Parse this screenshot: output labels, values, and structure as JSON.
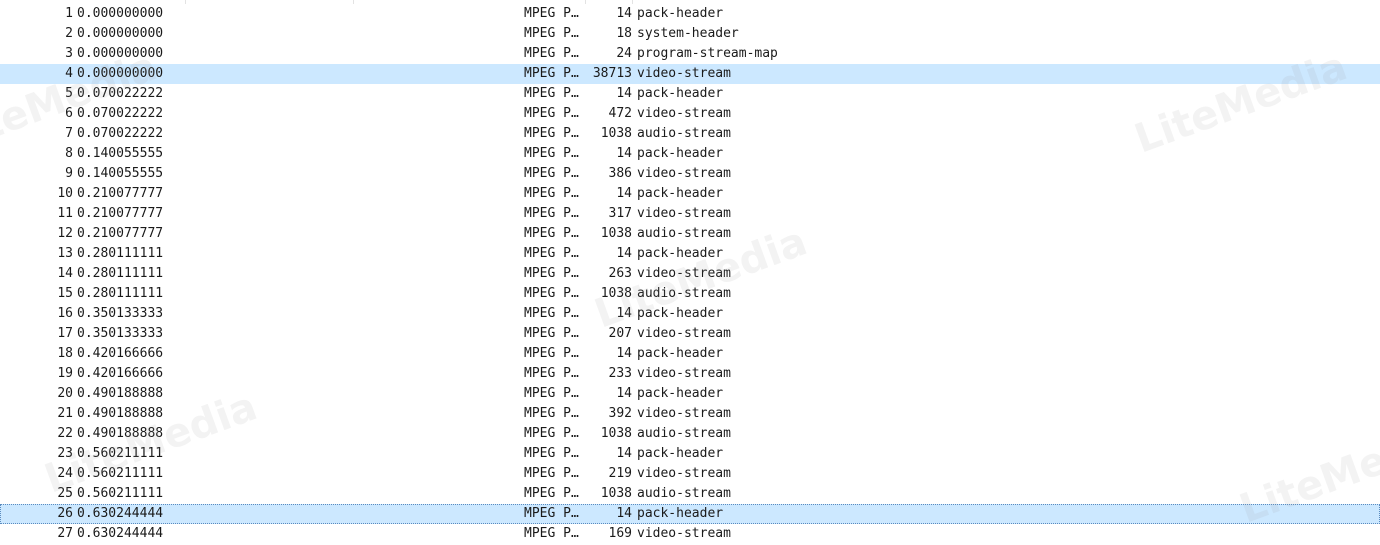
{
  "packets": [
    {
      "no": "1",
      "time": "0.000000000",
      "protocol": "MPEG P…",
      "length": "14",
      "info": "pack-header"
    },
    {
      "no": "2",
      "time": "0.000000000",
      "protocol": "MPEG P…",
      "length": "18",
      "info": "system-header"
    },
    {
      "no": "3",
      "time": "0.000000000",
      "protocol": "MPEG P…",
      "length": "24",
      "info": "program-stream-map"
    },
    {
      "no": "4",
      "time": "0.000000000",
      "protocol": "MPEG P…",
      "length": "38713",
      "info": "video-stream"
    },
    {
      "no": "5",
      "time": "0.070022222",
      "protocol": "MPEG P…",
      "length": "14",
      "info": "pack-header"
    },
    {
      "no": "6",
      "time": "0.070022222",
      "protocol": "MPEG P…",
      "length": "472",
      "info": "video-stream"
    },
    {
      "no": "7",
      "time": "0.070022222",
      "protocol": "MPEG P…",
      "length": "1038",
      "info": "audio-stream"
    },
    {
      "no": "8",
      "time": "0.140055555",
      "protocol": "MPEG P…",
      "length": "14",
      "info": "pack-header"
    },
    {
      "no": "9",
      "time": "0.140055555",
      "protocol": "MPEG P…",
      "length": "386",
      "info": "video-stream"
    },
    {
      "no": "10",
      "time": "0.210077777",
      "protocol": "MPEG P…",
      "length": "14",
      "info": "pack-header"
    },
    {
      "no": "11",
      "time": "0.210077777",
      "protocol": "MPEG P…",
      "length": "317",
      "info": "video-stream"
    },
    {
      "no": "12",
      "time": "0.210077777",
      "protocol": "MPEG P…",
      "length": "1038",
      "info": "audio-stream"
    },
    {
      "no": "13",
      "time": "0.280111111",
      "protocol": "MPEG P…",
      "length": "14",
      "info": "pack-header"
    },
    {
      "no": "14",
      "time": "0.280111111",
      "protocol": "MPEG P…",
      "length": "263",
      "info": "video-stream"
    },
    {
      "no": "15",
      "time": "0.280111111",
      "protocol": "MPEG P…",
      "length": "1038",
      "info": "audio-stream"
    },
    {
      "no": "16",
      "time": "0.350133333",
      "protocol": "MPEG P…",
      "length": "14",
      "info": "pack-header"
    },
    {
      "no": "17",
      "time": "0.350133333",
      "protocol": "MPEG P…",
      "length": "207",
      "info": "video-stream"
    },
    {
      "no": "18",
      "time": "0.420166666",
      "protocol": "MPEG P…",
      "length": "14",
      "info": "pack-header"
    },
    {
      "no": "19",
      "time": "0.420166666",
      "protocol": "MPEG P…",
      "length": "233",
      "info": "video-stream"
    },
    {
      "no": "20",
      "time": "0.490188888",
      "protocol": "MPEG P…",
      "length": "14",
      "info": "pack-header"
    },
    {
      "no": "21",
      "time": "0.490188888",
      "protocol": "MPEG P…",
      "length": "392",
      "info": "video-stream"
    },
    {
      "no": "22",
      "time": "0.490188888",
      "protocol": "MPEG P…",
      "length": "1038",
      "info": "audio-stream"
    },
    {
      "no": "23",
      "time": "0.560211111",
      "protocol": "MPEG P…",
      "length": "14",
      "info": "pack-header"
    },
    {
      "no": "24",
      "time": "0.560211111",
      "protocol": "MPEG P…",
      "length": "219",
      "info": "video-stream"
    },
    {
      "no": "25",
      "time": "0.560211111",
      "protocol": "MPEG P…",
      "length": "1038",
      "info": "audio-stream"
    },
    {
      "no": "26",
      "time": "0.630244444",
      "protocol": "MPEG P…",
      "length": "14",
      "info": "pack-header"
    },
    {
      "no": "27",
      "time": "0.630244444",
      "protocol": "MPEG P…",
      "length": "169",
      "info": "video-stream"
    }
  ],
  "highlighted_row_numbers": [
    "4",
    "26"
  ],
  "focused_row_number": "26",
  "colors": {
    "selection": "#cce8ff",
    "focus_outline": "#5a8bbf",
    "text": "#1a1a1a"
  },
  "watermark": {
    "text": "LiteMedia"
  }
}
